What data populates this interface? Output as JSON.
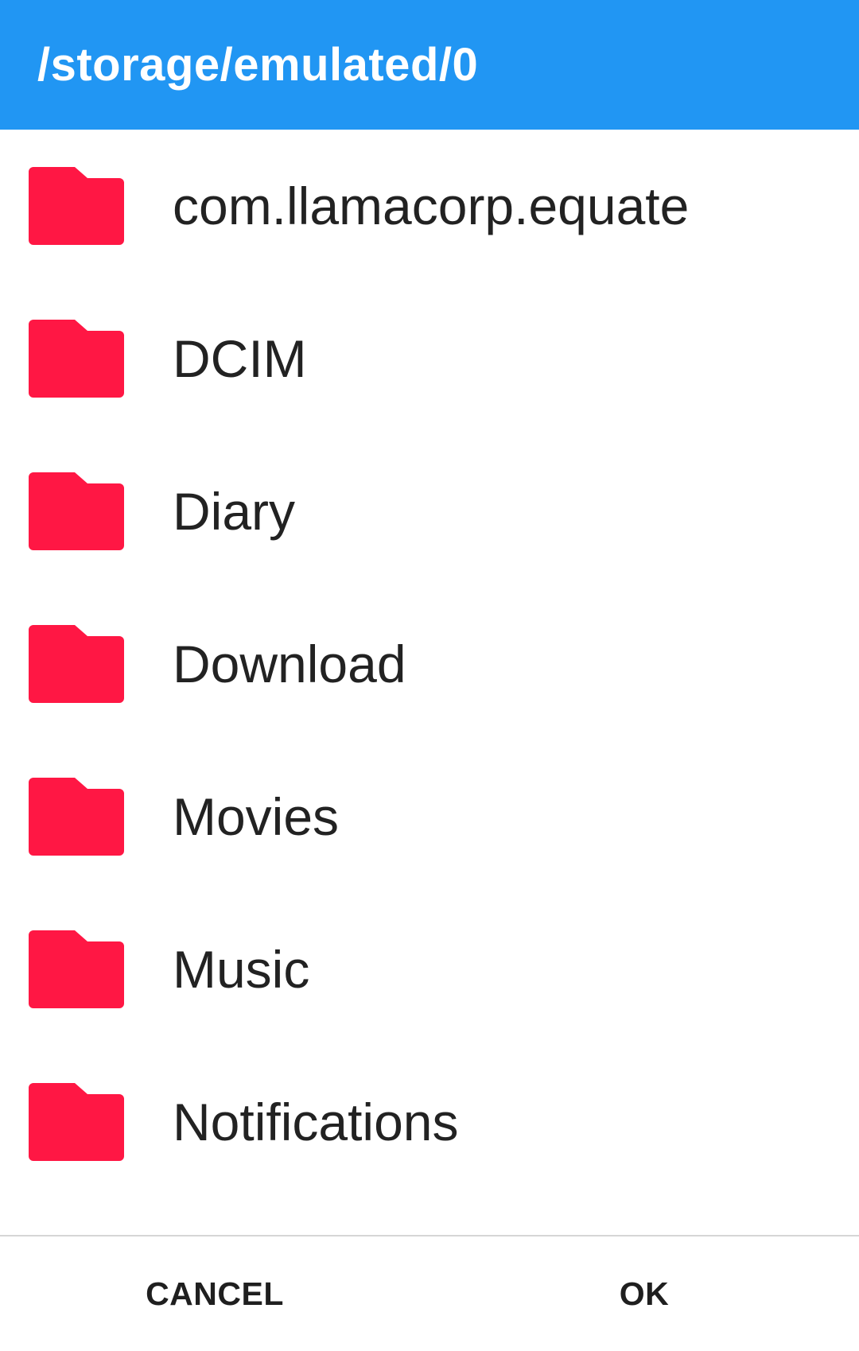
{
  "header": {
    "title": "/storage/emulated/0",
    "background_color": "#2196F3"
  },
  "folders": [
    {
      "label": "com.llamacorp.equate",
      "icon": "folder-icon"
    },
    {
      "label": "DCIM",
      "icon": "folder-icon"
    },
    {
      "label": "Diary",
      "icon": "folder-icon"
    },
    {
      "label": "Download",
      "icon": "folder-icon"
    },
    {
      "label": "Movies",
      "icon": "folder-icon"
    },
    {
      "label": "Music",
      "icon": "folder-icon"
    },
    {
      "label": "Notifications",
      "icon": "folder-icon"
    }
  ],
  "folder_icon_color": "#FF1744",
  "footer": {
    "cancel_label": "CANCEL",
    "ok_label": "OK"
  }
}
